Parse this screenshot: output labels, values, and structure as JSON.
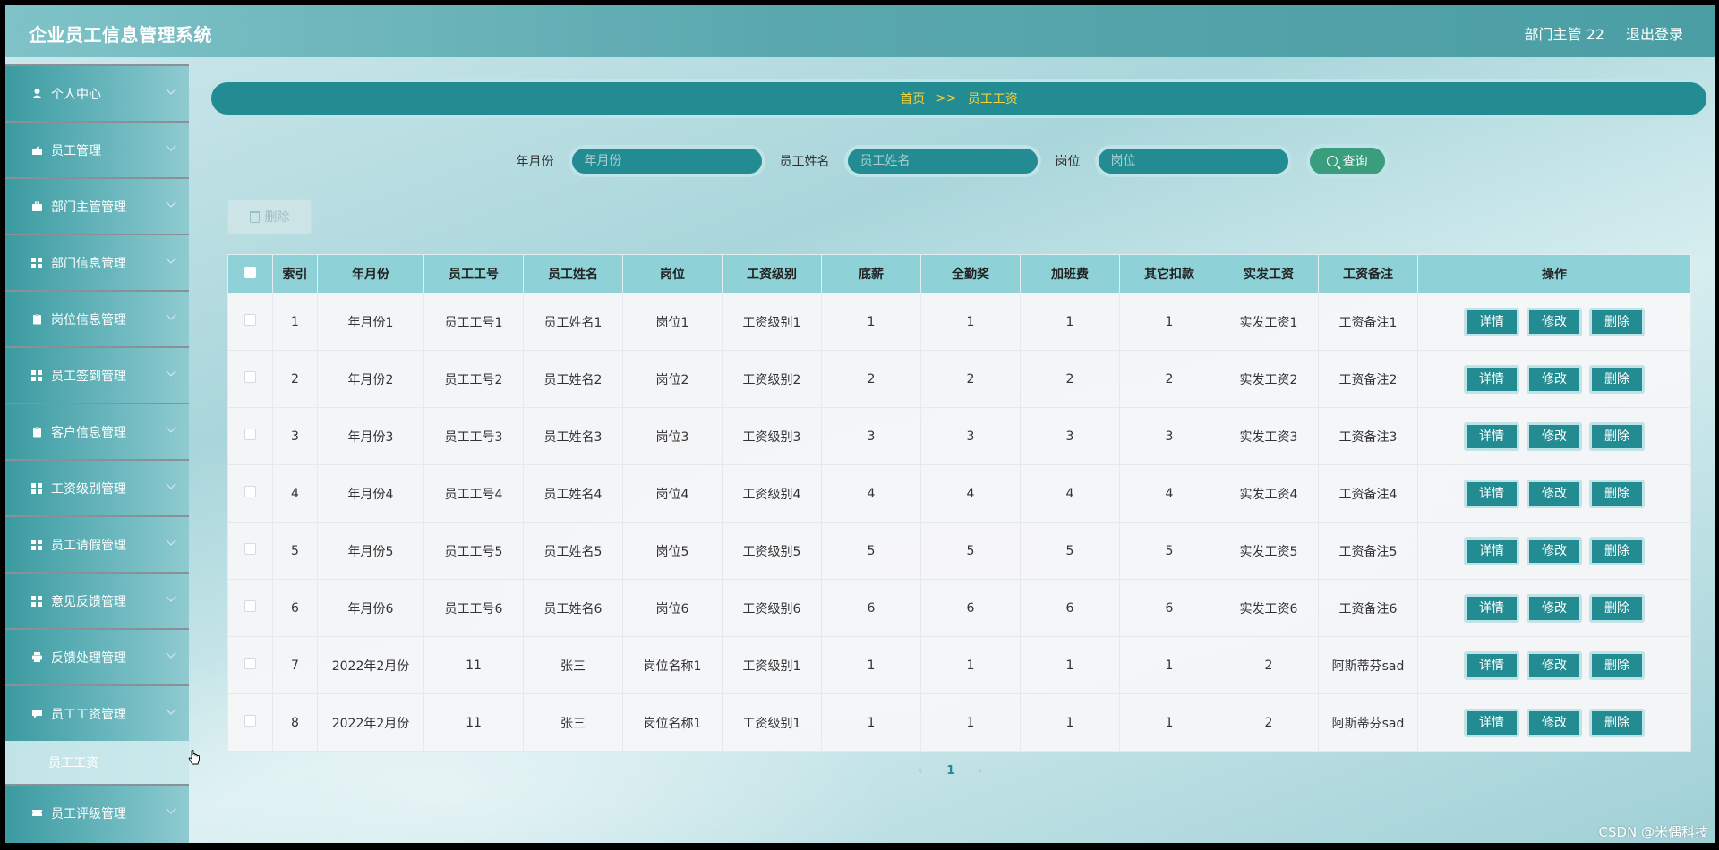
{
  "header": {
    "app_title": "企业员工信息管理系统",
    "user": "部门主管 22",
    "logout": "退出登录"
  },
  "sidebar": {
    "items": [
      {
        "label": "个人中心",
        "icon": "user-icon"
      },
      {
        "label": "员工管理",
        "icon": "hand-icon"
      },
      {
        "label": "部门主管管理",
        "icon": "briefcase-icon"
      },
      {
        "label": "部门信息管理",
        "icon": "grid-icon"
      },
      {
        "label": "岗位信息管理",
        "icon": "clipboard-icon"
      },
      {
        "label": "员工签到管理",
        "icon": "grid-icon"
      },
      {
        "label": "客户信息管理",
        "icon": "clipboard-icon"
      },
      {
        "label": "工资级别管理",
        "icon": "grid-icon"
      },
      {
        "label": "员工请假管理",
        "icon": "grid-icon"
      },
      {
        "label": "意见反馈管理",
        "icon": "grid-icon"
      },
      {
        "label": "反馈处理管理",
        "icon": "print-icon"
      },
      {
        "label": "员工工资管理",
        "icon": "chat-icon"
      }
    ],
    "active_sub": "员工工资",
    "last_item": {
      "label": "员工评级管理",
      "icon": "ticket-icon"
    }
  },
  "breadcrumb": {
    "home": "首页",
    "sep": ">>",
    "current": "员工工资"
  },
  "search": {
    "month_label": "年月份",
    "month_placeholder": "年月份",
    "name_label": "员工姓名",
    "name_placeholder": "员工姓名",
    "post_label": "岗位",
    "post_placeholder": "岗位",
    "button": "查询"
  },
  "batch_delete": "删除",
  "table": {
    "headers": [
      "索引",
      "年月份",
      "员工工号",
      "员工姓名",
      "岗位",
      "工资级别",
      "底薪",
      "全勤奖",
      "加班费",
      "其它扣款",
      "实发工资",
      "工资备注",
      "操作"
    ],
    "rows": [
      [
        "1",
        "年月份1",
        "员工工号1",
        "员工姓名1",
        "岗位1",
        "工资级别1",
        "1",
        "1",
        "1",
        "1",
        "实发工资1",
        "工资备注1"
      ],
      [
        "2",
        "年月份2",
        "员工工号2",
        "员工姓名2",
        "岗位2",
        "工资级别2",
        "2",
        "2",
        "2",
        "2",
        "实发工资2",
        "工资备注2"
      ],
      [
        "3",
        "年月份3",
        "员工工号3",
        "员工姓名3",
        "岗位3",
        "工资级别3",
        "3",
        "3",
        "3",
        "3",
        "实发工资3",
        "工资备注3"
      ],
      [
        "4",
        "年月份4",
        "员工工号4",
        "员工姓名4",
        "岗位4",
        "工资级别4",
        "4",
        "4",
        "4",
        "4",
        "实发工资4",
        "工资备注4"
      ],
      [
        "5",
        "年月份5",
        "员工工号5",
        "员工姓名5",
        "岗位5",
        "工资级别5",
        "5",
        "5",
        "5",
        "5",
        "实发工资5",
        "工资备注5"
      ],
      [
        "6",
        "年月份6",
        "员工工号6",
        "员工姓名6",
        "岗位6",
        "工资级别6",
        "6",
        "6",
        "6",
        "6",
        "实发工资6",
        "工资备注6"
      ],
      [
        "7",
        "2022年2月份",
        "11",
        "张三",
        "岗位名称1",
        "工资级别1",
        "1",
        "1",
        "1",
        "1",
        "2",
        "阿斯蒂芬sad"
      ],
      [
        "8",
        "2022年2月份",
        "11",
        "张三",
        "岗位名称1",
        "工资级别1",
        "1",
        "1",
        "1",
        "1",
        "2",
        "阿斯蒂芬sad"
      ]
    ],
    "actions": {
      "detail": "详情",
      "edit": "修改",
      "delete": "删除"
    }
  },
  "pagination": {
    "prev": "‹",
    "current": "1",
    "next": "›"
  },
  "watermark": "CSDN @米偶科技",
  "colors": {
    "primary": "#238b92",
    "breadcrumb_text": "#f4d23a",
    "search_btn": "#3a9e7e",
    "header_row": "#8ed2d8"
  }
}
